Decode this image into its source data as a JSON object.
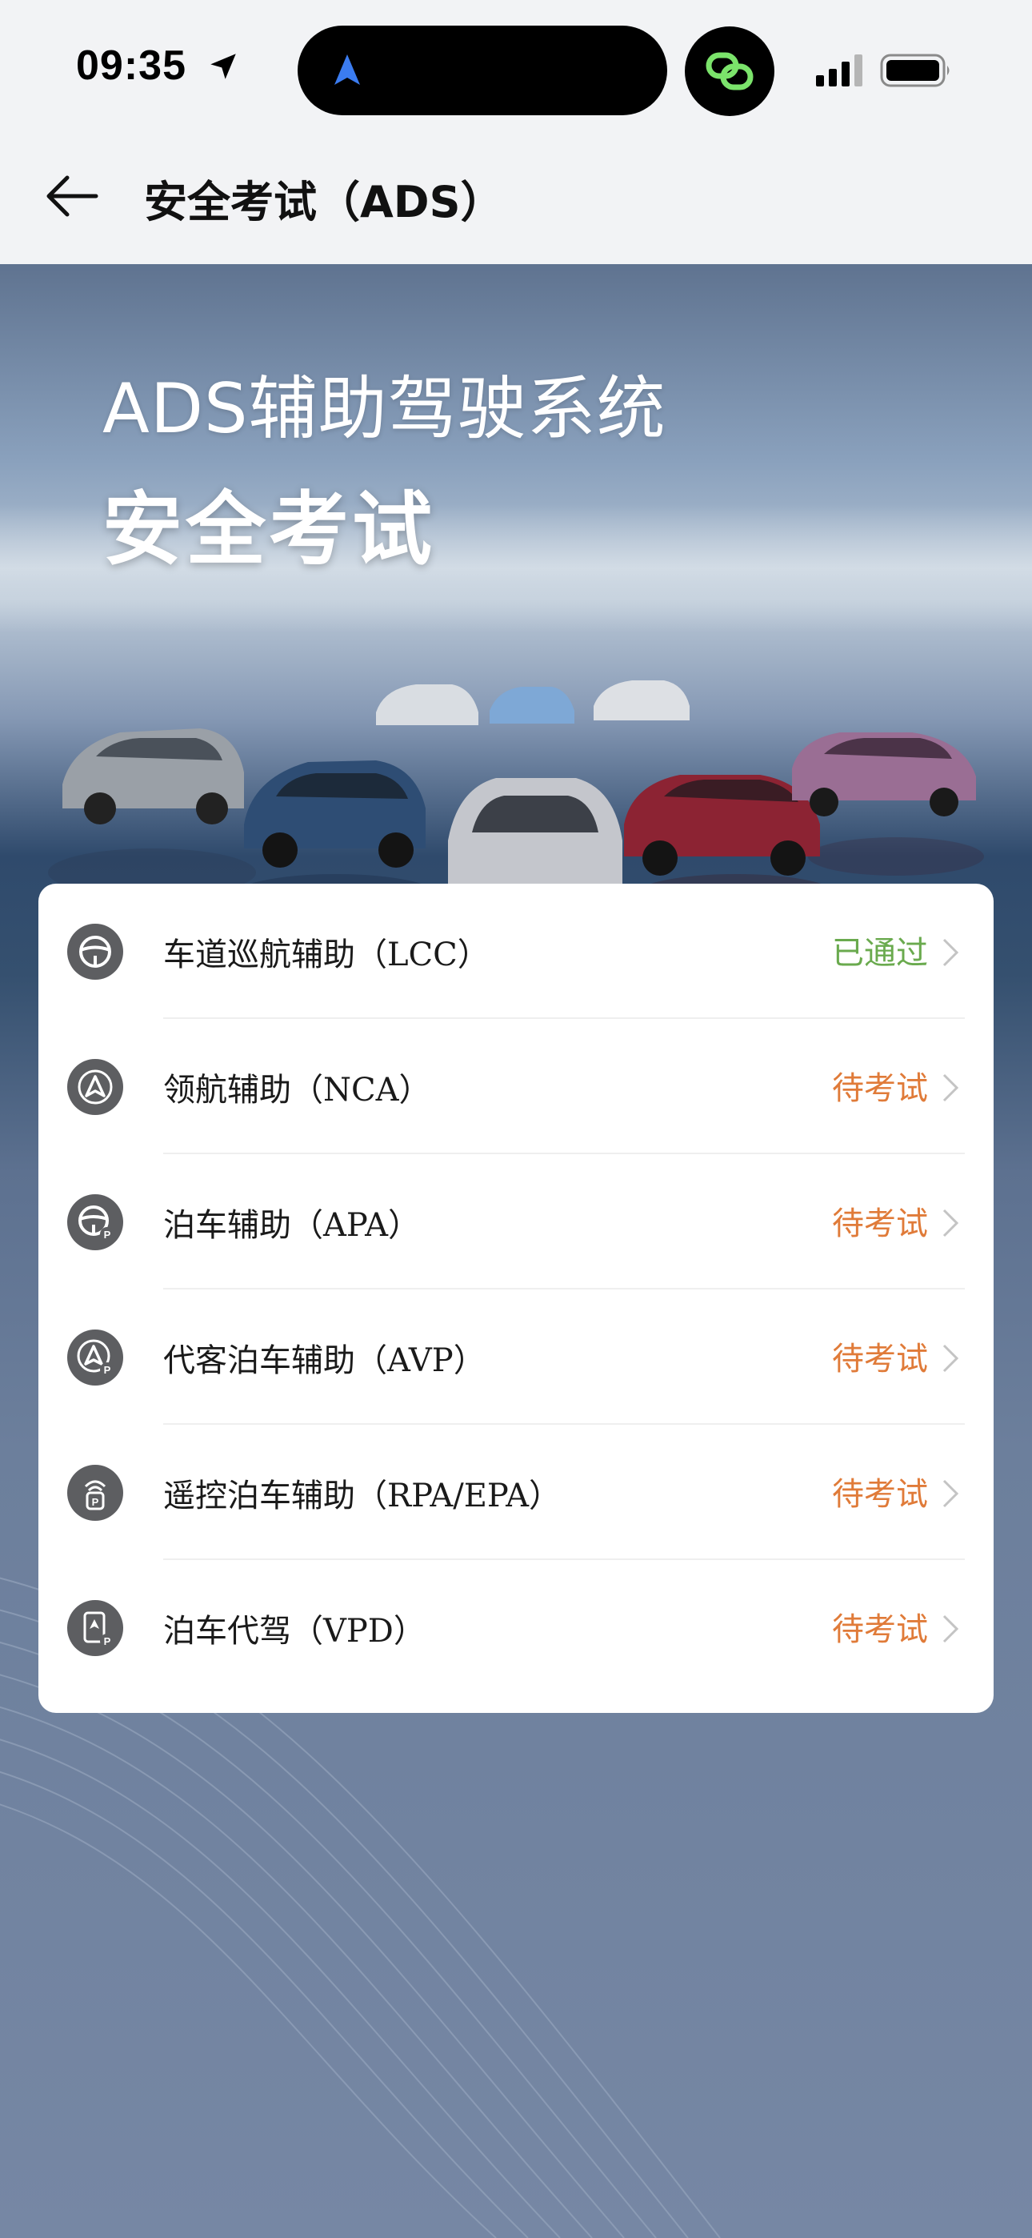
{
  "status_bar": {
    "time": "09:35"
  },
  "header": {
    "title": "安全考试（ADS）"
  },
  "hero": {
    "subtitle": "ADS辅助驾驶系统",
    "title": "安全考试"
  },
  "colors": {
    "passed": "#6aaa4e",
    "pending": "#e07b39",
    "icon_bg": "#5d5e61",
    "chat_green": "#7be36b"
  },
  "exams": [
    {
      "label": "车道巡航辅助（LCC）",
      "status": "已通过",
      "status_type": "passed",
      "icon": "steering-wheel-icon"
    },
    {
      "label": "领航辅助（NCA）",
      "status": "待考试",
      "status_type": "pending",
      "icon": "navigation-triangle-icon"
    },
    {
      "label": "泊车辅助（APA）",
      "status": "待考试",
      "status_type": "pending",
      "icon": "steering-wheel-parking-icon"
    },
    {
      "label": "代客泊车辅助（AVP）",
      "status": "待考试",
      "status_type": "pending",
      "icon": "navigation-parking-icon"
    },
    {
      "label": "遥控泊车辅助（RPA/EPA）",
      "status": "待考试",
      "status_type": "pending",
      "icon": "remote-parking-icon"
    },
    {
      "label": "泊车代驾（VPD）",
      "status": "待考试",
      "status_type": "pending",
      "icon": "phone-parking-icon"
    }
  ]
}
